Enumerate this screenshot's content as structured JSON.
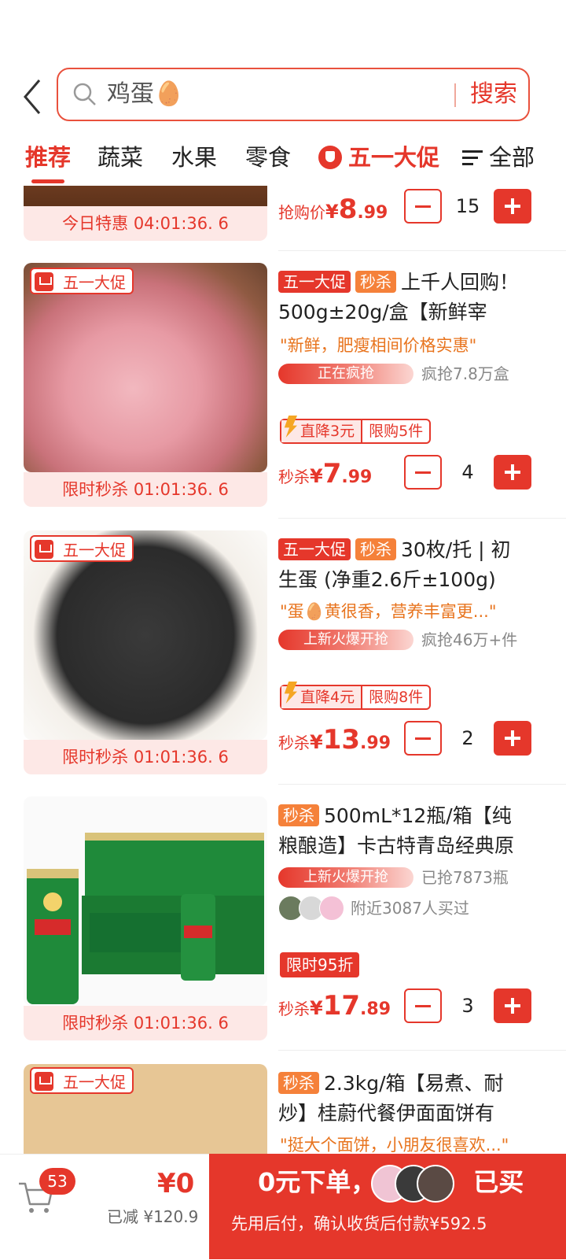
{
  "search": {
    "query": "鸡蛋🥚",
    "button": "搜索"
  },
  "tabs": [
    {
      "label": "推荐",
      "active": true
    },
    {
      "label": "蔬菜"
    },
    {
      "label": "水果"
    },
    {
      "label": "零食"
    },
    {
      "label": "五一大促"
    },
    {
      "label": "全部"
    }
  ],
  "products": [
    {
      "footer": "今日特惠 04:01:36. 6",
      "price_label": "抢购价",
      "currency": "¥",
      "price_int": "8",
      "price_dec": ".99",
      "qty": "15"
    },
    {
      "badge": "五一大促",
      "chips": [
        "五一大促",
        "秒杀"
      ],
      "title1": "上千人回购！",
      "title2": "500g±20g/盒【新鲜宰",
      "quote": "\"新鲜，肥瘦相间价格实惠\"",
      "heat": "正在疯抢",
      "heat_note": "疯抢7.8万盒",
      "drop": "直降3元",
      "limit": "限购5件",
      "price_label": "秒杀",
      "currency": "¥",
      "price_int": "7",
      "price_dec": ".99",
      "qty": "4",
      "footer": "限时秒杀 01:01:36. 6"
    },
    {
      "badge": "五一大促",
      "chips": [
        "五一大促",
        "秒杀"
      ],
      "title1": "30枚/托 | 初",
      "title2": "生蛋 (净重2.6斤±100g)",
      "quote": "\"蛋🥚黄很香，营养丰富更...\"",
      "heat": "上新火爆开抢",
      "heat_note": "疯抢46万+件",
      "drop": "直降4元",
      "limit": "限购8件",
      "price_label": "秒杀",
      "currency": "¥",
      "price_int": "13",
      "price_dec": ".99",
      "qty": "2",
      "footer": "限时秒杀 01:01:36. 6"
    },
    {
      "chips": [
        "秒杀"
      ],
      "title1": "500mL*12瓶/箱【纯",
      "title2": "粮酿造】卡古特青岛经典原",
      "heat": "上新火爆开抢",
      "heat_note": "已抢7873瓶",
      "near": "附近3087人买过",
      "discount": "限时95折",
      "price_label": "秒杀",
      "currency": "¥",
      "price_int": "17",
      "price_dec": ".89",
      "qty": "3",
      "footer": "限时秒杀 01:01:36. 6"
    },
    {
      "badge": "五一大促",
      "chips": [
        "秒杀"
      ],
      "title1": "2.3kg/箱【易煮、耐",
      "title2": "炒】桂蔚代餐伊面面饼有",
      "quote": "\"挺大个面饼，小朋友很喜欢...\""
    }
  ],
  "bottom": {
    "cart_count": "53",
    "total": "¥0",
    "saved": "已减 ¥120.9",
    "buy_main_a": "0元下单，",
    "buy_main_b": "已买",
    "buy_sub": "先用后付，确认收货后付款¥592.5"
  },
  "colors": {
    "accent": "#e5372b",
    "orange": "#f5813a",
    "quote": "#e8741e"
  }
}
